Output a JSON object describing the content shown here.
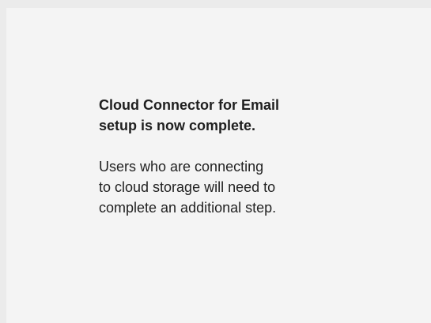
{
  "completion": {
    "heading_line1": "Cloud Connector for Email",
    "heading_line2": "setup is now complete.",
    "body_line1": "Users who are connecting",
    "body_line2": "to cloud storage will need to",
    "body_line3": "complete an additional step."
  }
}
